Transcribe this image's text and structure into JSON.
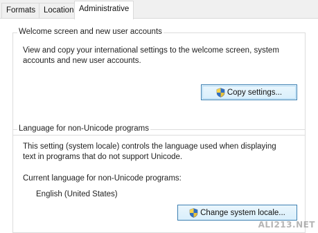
{
  "tabs": [
    {
      "label": "Formats",
      "active": false
    },
    {
      "label": "Location",
      "active": false
    },
    {
      "label": "Administrative",
      "active": true
    }
  ],
  "welcome_group": {
    "title": "Welcome screen and new user accounts",
    "description_line1": "View and copy your international settings to the welcome screen, system",
    "description_line2": "accounts and new user accounts.",
    "copy_button_label": "Copy settings..."
  },
  "unicode_group": {
    "title": "Language for non-Unicode programs",
    "description_line1": "This setting (system locale) controls the language used when displaying",
    "description_line2": "text in programs that do not support Unicode.",
    "current_label": "Current language for non-Unicode programs:",
    "current_value": "English (United States)",
    "change_button_label": "Change system locale..."
  },
  "watermark": "ALI213.NET",
  "icons": {
    "uac_shield": "uac-shield-icon"
  },
  "colors": {
    "button_border": "#3c7fb1",
    "button_face": "#dcf0fc",
    "group_border": "#dcdcdc"
  }
}
